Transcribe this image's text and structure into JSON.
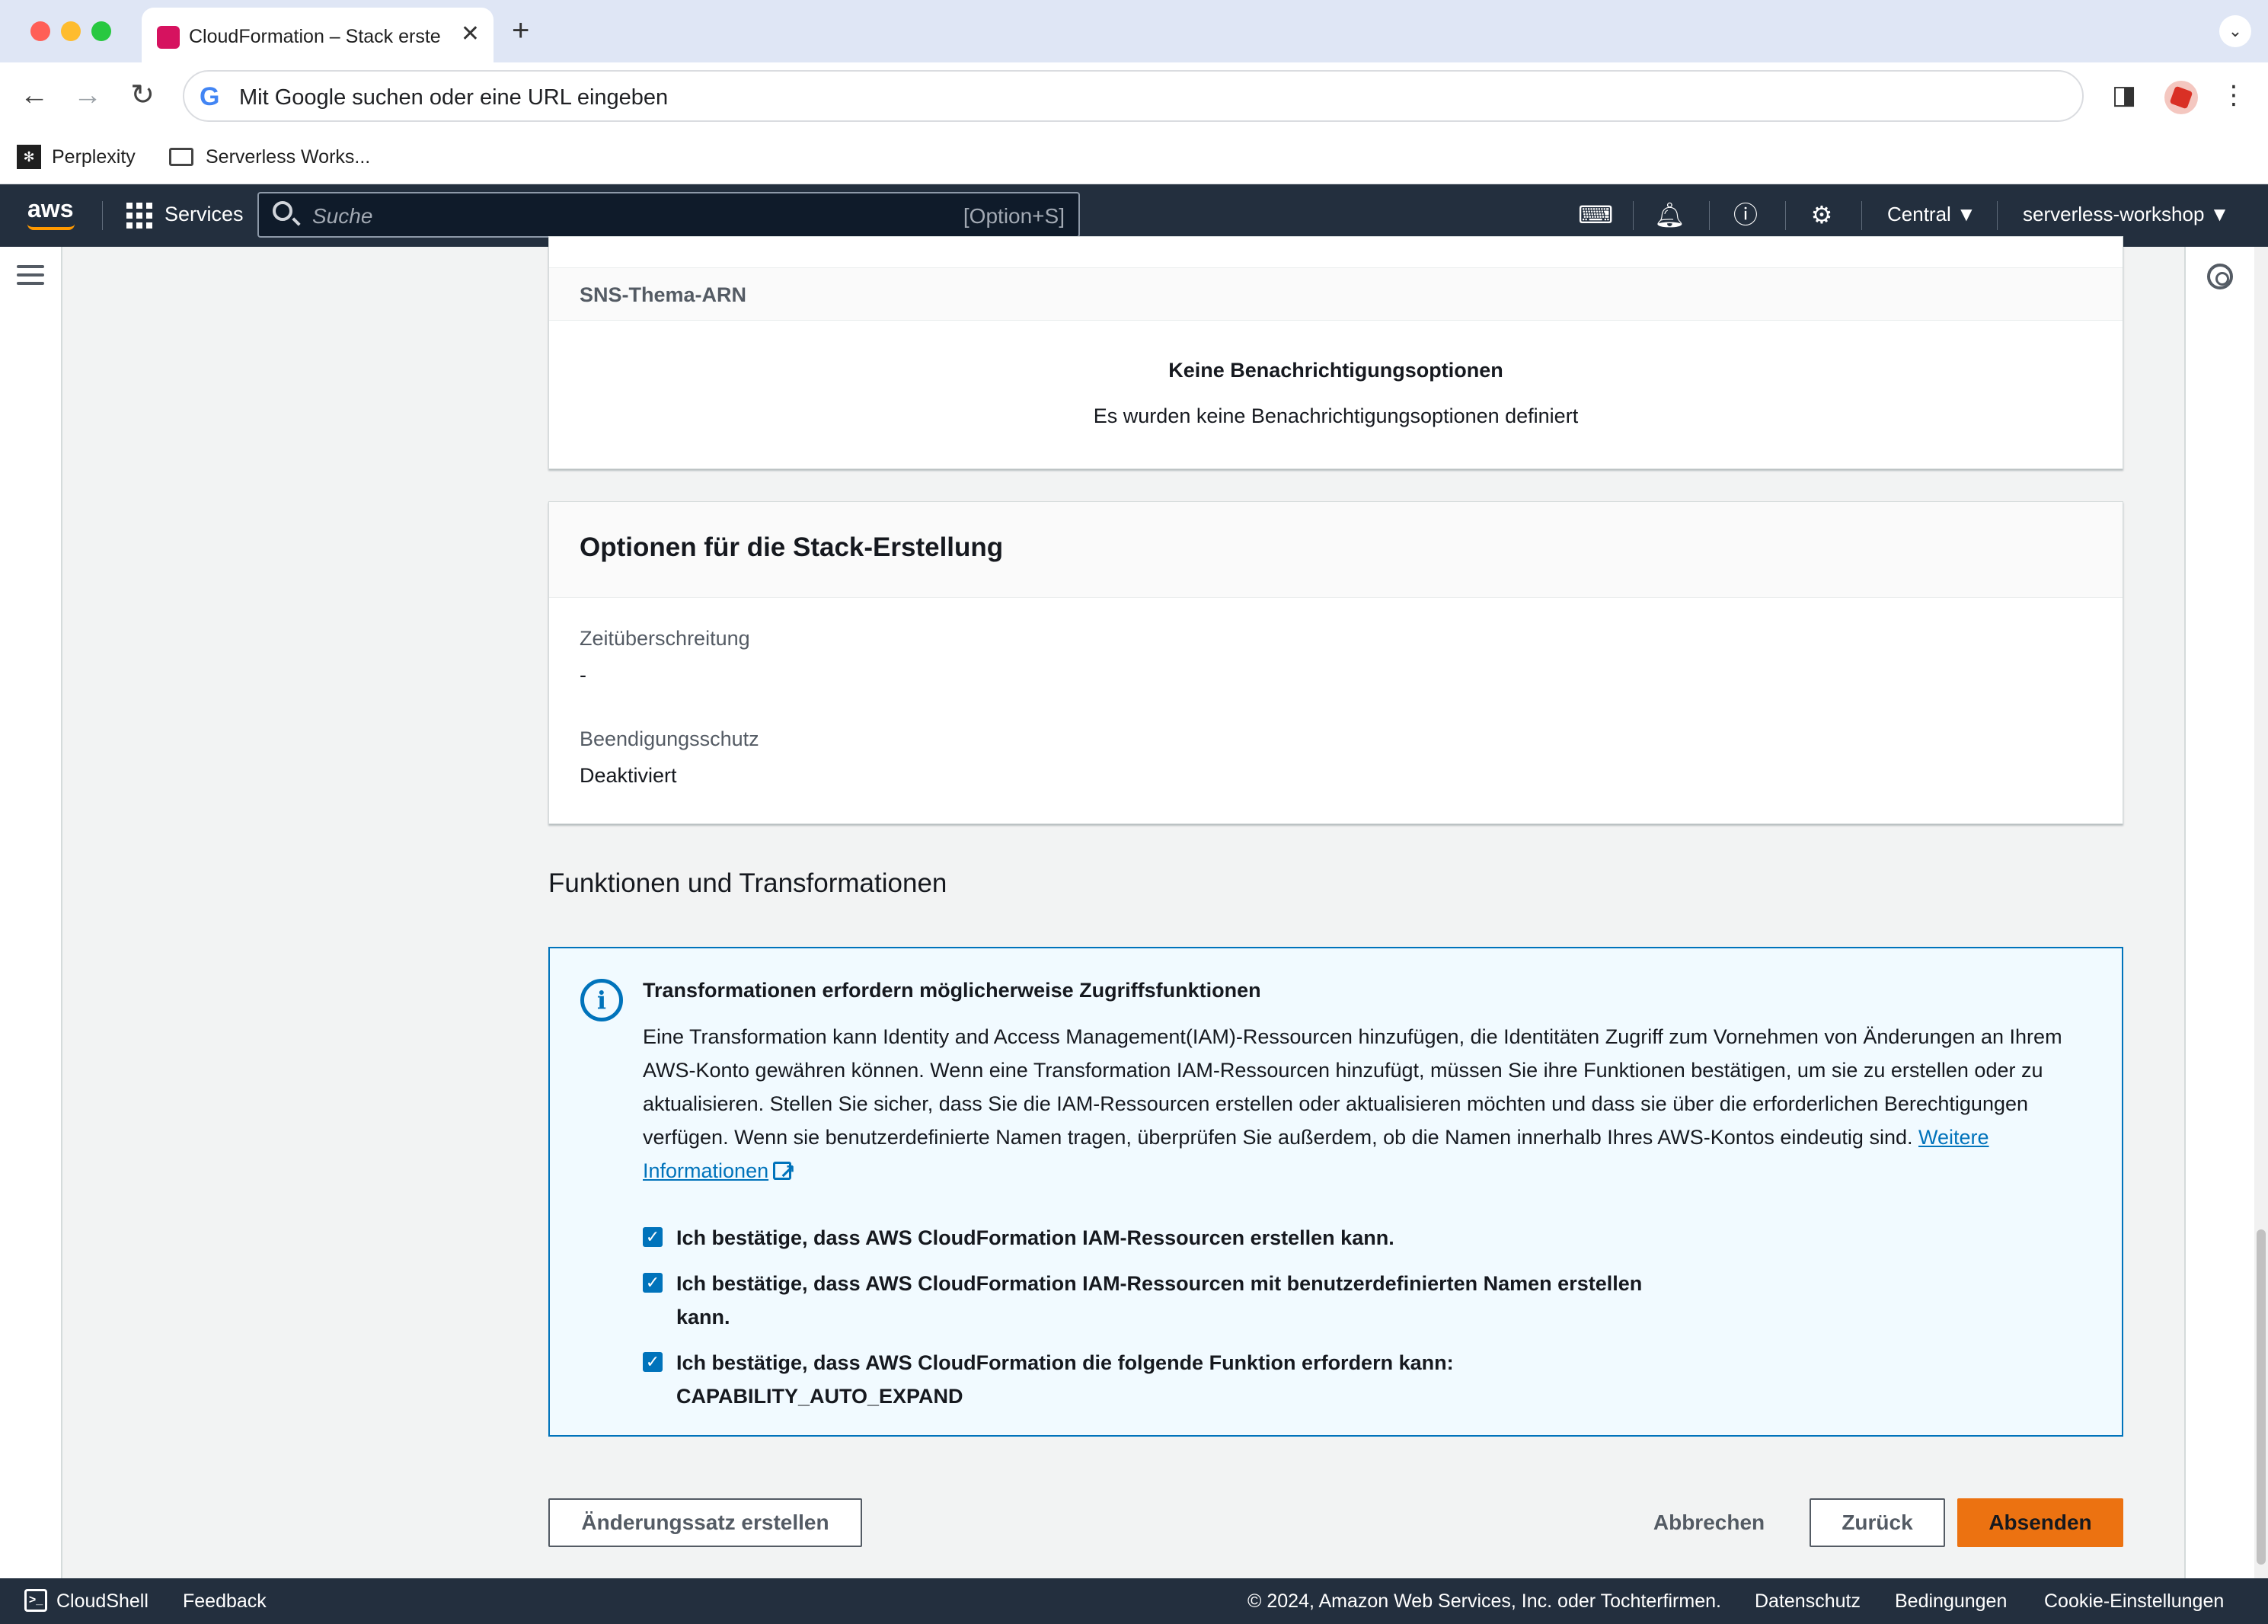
{
  "browser": {
    "tab_title": "CloudFormation – Stack erstellen",
    "new_tab": "+",
    "tab_close": "✕",
    "tab_menu": "⌄",
    "omnibox_placeholder": "Mit Google suchen oder eine URL eingeben",
    "omnibox_logo": "G",
    "bookmarks": [
      "Perplexity",
      "Serverless Works..."
    ]
  },
  "aws_nav": {
    "logo": "aws",
    "services_label": "Services",
    "search_placeholder": "Suche",
    "search_shortcut": "[Option+S]",
    "region": "Central ▼",
    "account": "serverless-workshop ▼"
  },
  "notifications": {
    "column_header": "SNS-Thema-ARN",
    "empty_title": "Keine Benachrichtigungsoptionen",
    "empty_description": "Es wurden keine Benachrichtigungsoptionen definiert"
  },
  "stack_options": {
    "title": "Optionen für die Stack-Erstellung",
    "timeout_label": "Zeitüberschreitung",
    "timeout_value": "-",
    "termination_label": "Beendigungsschutz",
    "termination_value": "Deaktiviert"
  },
  "capabilities": {
    "section_title": "Funktionen und Transformationen",
    "alert_title": "Transformationen erfordern möglicherweise Zugriffsfunktionen",
    "alert_body": "Eine Transformation kann Identity and Access Management(IAM)-Ressourcen hinzufügen, die Identitäten Zugriff zum Vornehmen von Änderungen an Ihrem AWS-Konto gewähren können. Wenn eine Transformation IAM-Ressourcen hinzufügt, müssen Sie ihre Funktionen bestätigen, um sie zu erstellen oder zu aktualisieren. Stellen Sie sicher, dass Sie die IAM-Ressourcen erstellen oder aktualisieren möchten und dass sie über die erforderlichen Berechtigungen verfügen. Wenn sie benutzerdefinierte Namen tragen, überprüfen Sie außerdem, ob die Namen innerhalb Ihres AWS-Kontos eindeutig sind.",
    "learn_more": "Weitere Informationen",
    "checkbox_mark": "✓",
    "acknowledgements": [
      {
        "label": "Ich bestätige, dass AWS CloudFormation IAM-Ressourcen erstellen kann.",
        "checked": true
      },
      {
        "label": "Ich bestätige, dass AWS CloudFormation IAM-Ressourcen mit benutzerdefinierten Namen erstellen kann.",
        "checked": true
      },
      {
        "label": "Ich bestätige, dass AWS CloudFormation die folgende Funktion erfordern kann: CAPABILITY_AUTO_EXPAND",
        "checked": true
      }
    ]
  },
  "actions": {
    "create_change_set": "Änderungssatz erstellen",
    "cancel": "Abbrechen",
    "back": "Zurück",
    "submit": "Absenden"
  },
  "footer": {
    "cloudshell": "CloudShell",
    "feedback": "Feedback",
    "copyright": "© 2024, Amazon Web Services, Inc. oder Tochterfirmen.",
    "privacy": "Datenschutz",
    "terms": "Bedingungen",
    "cookies": "Cookie-Einstellungen"
  },
  "colors": {
    "aws_nav_bg": "#232f3e",
    "primary_button": "#ec7211",
    "info_border": "#0073bb",
    "info_bg": "#f1faff"
  }
}
